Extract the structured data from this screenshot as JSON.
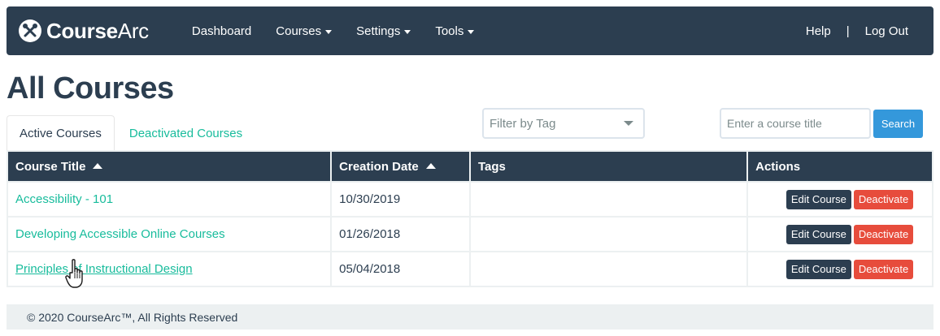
{
  "nav": {
    "brand_bold": "Course",
    "brand_light": "Arc",
    "items": [
      {
        "label": "Dashboard",
        "dropdown": false
      },
      {
        "label": "Courses",
        "dropdown": true
      },
      {
        "label": "Settings",
        "dropdown": true
      },
      {
        "label": "Tools",
        "dropdown": true
      }
    ],
    "help": "Help",
    "separator": "|",
    "logout": "Log Out"
  },
  "page_title": "All Courses",
  "tabs": {
    "active": "Active Courses",
    "inactive": "Deactivated Courses"
  },
  "filter": {
    "placeholder": "Filter by Tag"
  },
  "search": {
    "placeholder": "Enter a course title",
    "button": "Search"
  },
  "table": {
    "headers": [
      "Course Title",
      "Creation Date",
      "Tags",
      "Actions"
    ],
    "rows": [
      {
        "title": "Accessibility - 101",
        "date": "10/30/2019",
        "tags": "",
        "edit": "Edit Course",
        "deactivate": "Deactivate"
      },
      {
        "title": "Developing Accessible Online Courses",
        "date": "01/26/2018",
        "tags": "",
        "edit": "Edit Course",
        "deactivate": "Deactivate"
      },
      {
        "title": "Principles of Instructional Design",
        "date": "05/04/2018",
        "tags": "",
        "edit": "Edit Course",
        "deactivate": "Deactivate"
      }
    ]
  },
  "footer": {
    "text": "© 2020 CourseArc™, All Rights Reserved"
  },
  "colors": {
    "primary": "#2c3e50",
    "link": "#18bc9c",
    "info": "#3498db",
    "danger": "#e74c3c",
    "light": "#ecf0f1"
  }
}
